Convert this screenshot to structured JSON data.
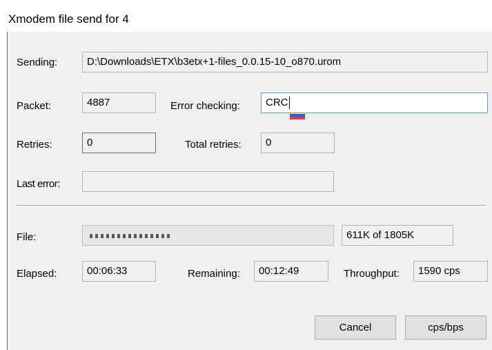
{
  "window": {
    "title": "Xmodem file send for 4"
  },
  "labels": {
    "sending": "Sending:",
    "packet": "Packet:",
    "error_checking": "Error checking:",
    "retries": "Retries:",
    "total_retries": "Total retries:",
    "last_error": "Last error:",
    "file": "File:",
    "elapsed": "Elapsed:",
    "remaining": "Remaining:",
    "throughput": "Throughput:"
  },
  "values": {
    "sending": "D:\\Downloads\\ETX\\b3etx+1-files_0.0.15-10_o870.urom",
    "packet": "4887",
    "error_checking": "CRC",
    "retries": "0",
    "total_retries": "0",
    "last_error": "",
    "file_progress": "611K of 1805K",
    "elapsed": "00:06:33",
    "remaining": "00:12:49",
    "throughput": "1590 cps"
  },
  "progress": {
    "fraction": 0.339
  },
  "buttons": {
    "cancel": "Cancel",
    "cps_bps": "cps/bps"
  },
  "colors": {
    "focus_border": "#5b9bd5",
    "dialog_bg": "#f0f0f0"
  }
}
